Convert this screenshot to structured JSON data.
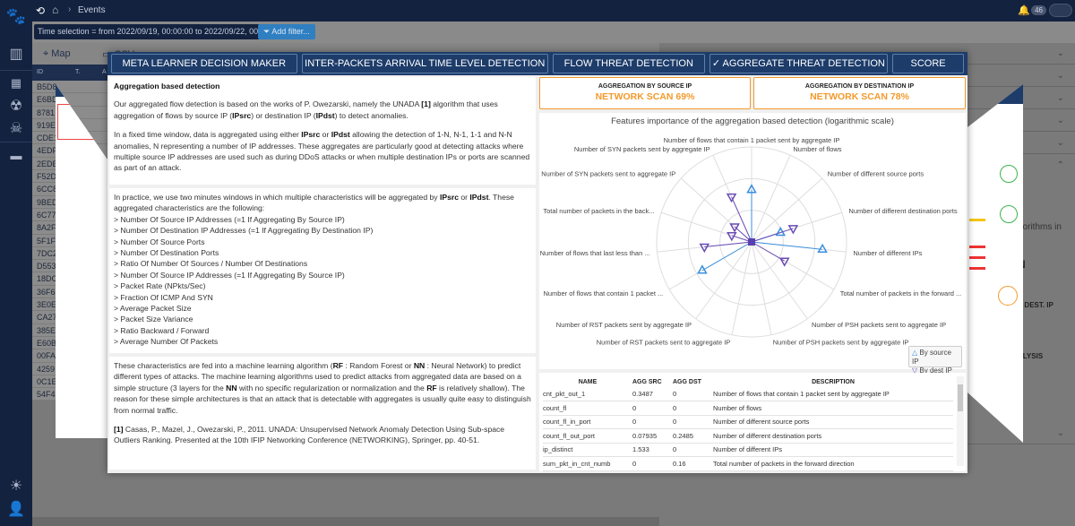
{
  "topbar": {
    "breadcrumb": "Events",
    "notification_count": "46"
  },
  "filterbar": {
    "time_selection": "Time selection = from 2022/09/19, 00:00:00 to 2022/09/22, 00:00:00",
    "add_filter": "Add filter..."
  },
  "toolbar": {
    "map_label": "Map",
    "csv_label": "CSV"
  },
  "event_list": {
    "headers": [
      "ID",
      "T.",
      "A"
    ],
    "ids": [
      "B5D8",
      "E6BD",
      "8781",
      "919E",
      "CDE1",
      "4EDF",
      "2EDE",
      "F52D",
      "6CC8",
      "9BED",
      "6C77",
      "8A2F",
      "5F1F",
      "7DC2",
      "D553",
      "18DC",
      "36F6",
      "3E0E",
      "CA27",
      "385E",
      "E60B",
      "00FA",
      "4259",
      "0C1E",
      "54F4"
    ]
  },
  "modal": {
    "tabs": [
      {
        "label": "META LEARNER DECISION MAKER",
        "active": false
      },
      {
        "label": "INTER-PACKETS ARRIVAL TIME LEVEL DETECTION",
        "active": false
      },
      {
        "label": "FLOW THREAT DETECTION",
        "active": false
      },
      {
        "label": "✓ AGGREGATE THREAT DETECTION",
        "active": true
      },
      {
        "label": "SCORE",
        "active": false
      }
    ],
    "description": {
      "title": "Aggregation based detection",
      "p1_a": "Our aggregated flow detection is based on the works of P. Owezarski, namely the UNADA ",
      "p1_ref": "[1]",
      "p1_b": " algorithm that uses aggregation of flows by source IP (",
      "p1_ipsrc": "IPsrc",
      "p1_c": ") or destination IP (",
      "p1_ipdst": "IPdst",
      "p1_d": ") to detect anomalies.",
      "p2_a": "In a fixed time window, data is aggregated using either ",
      "p2_ipsrc": "IPsrc",
      "p2_b": " or ",
      "p2_ipdst": "IPdst",
      "p2_c": " allowing the detection of 1-N, N-1, 1-1 and N-N anomalies, N representing a number of IP addresses. These aggregates are particularly good at detecting attacks where multiple source IP addresses are used such as during DDoS attacks or when multiple destination IPs or ports are scanned as part of an attack.",
      "p3_a": "In practice, we use two minutes windows in which multiple characteristics will be aggregated by ",
      "p3_ipsrc": "IPsrc",
      "p3_b": " or ",
      "p3_ipdst": "IPdst",
      "p3_c": ". These aggregated characteristics are the following:",
      "characteristics": [
        "> Number Of Source IP Addresses (=1 If Aggregating By Source IP)",
        "> Number Of Destination IP Addresses (=1 If Aggregating By Destination IP)",
        "> Number Of Source Ports",
        "> Number Of Destination Ports",
        "> Ratio Of Number Of Sources / Number Of Destinations",
        "> Number Of Source IP Addresses (=1 If Aggregating By Source IP)",
        "> Packet Rate (NPkts/Sec)",
        "> Fraction Of ICMP And SYN",
        "> Average Packet Size",
        "> Packet Size Variance",
        "> Ratio Backward / Forward",
        "> Average Number Of Packets"
      ],
      "p4_a": "These characteristics are fed into a machine learning algorithm (",
      "p4_rf": "RF",
      "p4_b": " : Random Forest or ",
      "p4_nn": "NN",
      "p4_c": " : Neural Network) to predict different types of attacks. The machine learning algorithms used to predict attacks from aggregated data are based on a simple structure (3 layers for the ",
      "p4_nn2": "NN",
      "p4_d": " with no specific regularization or normalization and the ",
      "p4_rf2": "RF",
      "p4_e": " is relatively shallow). The reason for these simple architectures is that an attack that is detectable with aggregates is usually quite easy to distinguish from normal traffic.",
      "ref_num": "[1]",
      "ref_text": " Casas, P., Mazel, J., Owezarski, P., 2011. UNADA: Unsupervised Network Anomaly Detection Using Sub-space Outliers Ranking. Presented at the 10th IFIP Networking Conference (NETWORKING), Springer, pp. 40-51."
    },
    "scores": [
      {
        "label": "AGGREGATION BY SOURCE IP",
        "value": "NETWORK SCAN 69%"
      },
      {
        "label": "AGGREGATION BY DESTINATION IP",
        "value": "NETWORK SCAN 78%"
      }
    ],
    "colors": {
      "accent_orange": "#f39a2c",
      "tab_bg": "#1d3c6a",
      "series_src": "#3a8fdc",
      "series_dst": "#6a4bb5"
    },
    "table": {
      "headers": [
        "NAME",
        "AGG SRC",
        "AGG DST",
        "DESCRIPTION"
      ],
      "rows": [
        [
          "cnt_pkt_out_1",
          "0.3487",
          "0",
          "Number of flows that contain 1 packet sent by aggregate IP"
        ],
        [
          "count_fl",
          "0",
          "0",
          "Number of flows"
        ],
        [
          "count_fl_in_port",
          "0",
          "0",
          "Number of different source ports"
        ],
        [
          "count_fl_out_port",
          "0.07935",
          "0.2485",
          "Number of different destination ports"
        ],
        [
          "ip_distinct",
          "1.533",
          "0",
          "Number of different IPs"
        ],
        [
          "sum_pkt_in_cnt_numb",
          "0",
          "0.16",
          "Total number of packets in the forward direction"
        ]
      ]
    }
  },
  "chart_data": {
    "type": "radar",
    "title": "Features importance of the aggregation based detection (logarithmic scale)",
    "scale": "logarithmic",
    "categories": [
      "Number of flows that contain 1 packet sent by aggregate IP",
      "Number of flows",
      "Number of different source ports",
      "Number of different destination ports",
      "Number of different IPs",
      "Total number of packets in the forward ...",
      "Number of PSH packets sent to aggregate IP",
      "Number of PSH packets sent by aggregate IP",
      "Number of RST packets sent to aggregate IP",
      "Number of RST packets sent by aggregate IP",
      "Number of flows that contain 1 packet ...",
      "Number of flows that last less than ...",
      "Total number of packets in the back...",
      "Number of SYN packets sent to aggregate IP",
      "Number of SYN packets sent by aggregate IP"
    ],
    "series": [
      {
        "name": "By source IP",
        "marker": "triangle-up",
        "values": [
          0.55,
          0,
          0,
          0.32,
          0.75,
          0,
          0,
          0,
          0,
          0,
          0.6,
          0,
          0,
          0,
          0
        ]
      },
      {
        "name": "By dest IP",
        "marker": "triangle-down",
        "values": [
          0,
          0,
          0,
          0.46,
          0,
          0.4,
          0,
          0,
          0,
          0,
          0,
          0.5,
          0.22,
          0.24,
          0.52
        ]
      }
    ],
    "rings": 3,
    "legend": "bottom-right"
  },
  "right_panel": {
    "partial_texts": [
      "gorithms in",
      "N",
      "Y DEST. IP",
      "ALYSIS"
    ]
  }
}
